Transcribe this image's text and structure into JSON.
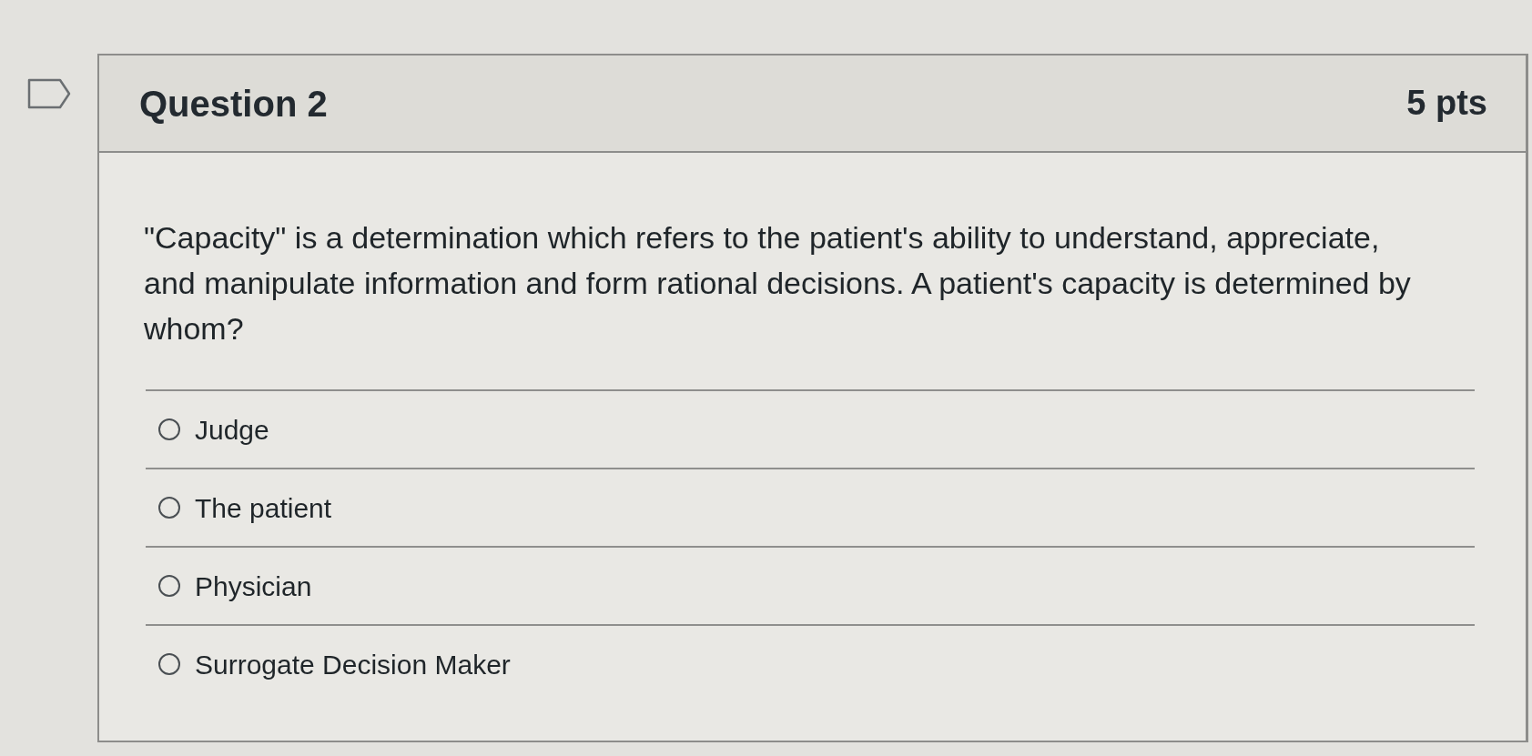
{
  "question": {
    "flagged": false,
    "title": "Question 2",
    "points": "5 pts",
    "text": "\"Capacity\" is a determination which refers to the patient's ability to understand, appreciate, and manipulate information and form rational decisions. A patient's capacity is determined by whom?",
    "answers": [
      {
        "label": "Judge",
        "selected": false
      },
      {
        "label": "The patient",
        "selected": false
      },
      {
        "label": "Physician",
        "selected": false
      },
      {
        "label": "Surrogate Decision Maker",
        "selected": false
      }
    ]
  }
}
